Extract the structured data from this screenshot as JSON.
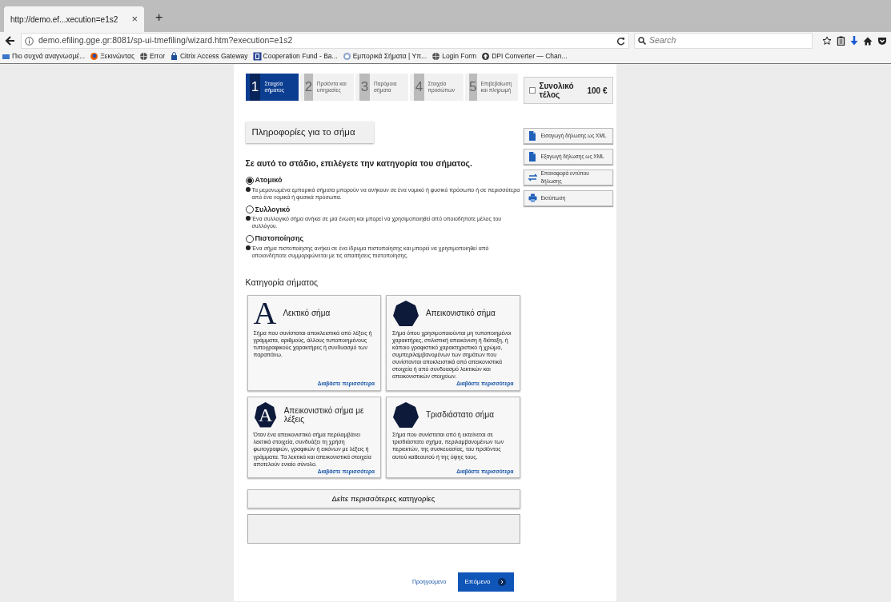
{
  "browser": {
    "tab": {
      "title": "http://demo.ef...xecution=e1s2",
      "close": "×",
      "new_tab": "+"
    },
    "url": "demo.efiling.gge.gr:8081/sp-ui-tmefiling/wizard.htm?execution=e1s2",
    "search": {
      "placeholder": "Search"
    },
    "bookmarks": [
      {
        "label": "Πιο συχνά αναγνωσμέ...",
        "kind": "folder"
      },
      {
        "label": "Ξεκινώντας",
        "kind": "firefox"
      },
      {
        "label": "Error",
        "kind": "globe"
      },
      {
        "label": "Citrix Access Gateway",
        "kind": "lock"
      },
      {
        "label": "Cooperation Fund - Ba...",
        "kind": "b"
      },
      {
        "label": "Εμπορικά Σήματα | Υπ...",
        "kind": "seal"
      },
      {
        "label": "Login Form",
        "kind": "globe"
      },
      {
        "label": "DPI Converter — Chan...",
        "kind": "up"
      }
    ]
  },
  "steps": [
    {
      "number": "1",
      "label": "Στοιχεία σήματος",
      "selected": true
    },
    {
      "number": "2",
      "label": "Προϊόντα και υπηρεσίες",
      "selected": false
    },
    {
      "number": "3",
      "label": "Παρόμοια σήματα",
      "selected": false
    },
    {
      "number": "4",
      "label": "Στοιχεία προσώπων",
      "selected": false
    },
    {
      "number": "5",
      "label": "Επιβεβαίωση και πληρωμή",
      "selected": false
    }
  ],
  "fee": {
    "label": "Συνολικό τέλος",
    "amount": "100 €"
  },
  "side_buttons": [
    {
      "label": "Εισαγωγή δήλωσης ως XML",
      "kind": "file"
    },
    {
      "label": "Εξαγωγή δήλωσης ως XML",
      "kind": "file"
    },
    {
      "label": "Επαναφορά εντύπου δήλωσης",
      "kind": "swap"
    },
    {
      "label": "Εκτύπωση",
      "kind": "print"
    }
  ],
  "section_title": "Πληροφορίες για το σήμα",
  "question": "Σε αυτό το στάδιο, επιλέγετε την κατηγορία του σήματος.",
  "options": [
    {
      "label": "Ατομικό",
      "selected": true,
      "help": "Τα μεμονωμένα εμπορικά σήματα μπορούν να ανήκουν σε ένα νομικό ή φυσικό πρόσωπο ή σε περισσότερα από ένα νομικά ή φυσικά πρόσωπα."
    },
    {
      "label": "Συλλογικό",
      "selected": false,
      "help": "Ένα συλλογικό σήμα ανήκει σε μια ένωση και μπορεί να χρησιμοποιηθεί από οποιοδήποτε μέλος του συλλόγου."
    },
    {
      "label": "Πιστοποίησης",
      "selected": false,
      "help": "Ένα σήμα πιστοποίησης ανήκει σε ένα ίδρυμα πιστοποίησης και μπορεί να χρησιμοποιηθεί από οποιονδήποτε συμμορφώνεται με τις απαιτήσεις πιστοποίησης."
    }
  ],
  "category_title": "Κατηγορία σήματος",
  "categories": [
    {
      "title": "Λεκτικό σήμα",
      "kind": "letter",
      "icon_text": "A",
      "description": "Σήμα που συνίσταται αποκλειστικά από λέξεις ή γράμματα, αριθμούς, άλλους τυποποιημένους τυπογραφικούς χαρακτήρες ή συνδυασμό των παραπάνω.",
      "link": "Διαβάστε περισσότερα"
    },
    {
      "title": "Απεικονιστικό σήμα",
      "kind": "shape",
      "description": "Σήμα όπου χρησιμοποιούνται μη τυποποιημένοι χαρακτήρες, στιλιστική απεικόνιση ή διάταξη, ή κάποιο γραφιστικό χαρακτηριστικό ή χρώμα, συμπεριλαμβανομένων των σημάτων που συνίστανται αποκλειστικά από απεικονιστικά στοιχεία ή από συνδυασμό λεκτικών και απεικονιστικών στοιχείων.",
      "link": "Διαβάστε περισσότερα"
    },
    {
      "title": "Απεικονιστικό σήμα με λέξεις",
      "kind": "shape_letter",
      "icon_text": "A",
      "description": "Όταν ένα απεικονιστικό σήμα περιλαμβάνει λεκτικά στοιχεία, συνδυάζει τη χρήση φωτογραφιών, γραφικών ή εικόνων με λέξεις ή γράμματα. Τα λεκτικά και απεικονιστικά στοιχεία αποτελούν ενιαίο σύνολο.",
      "link": "Διαβάστε περισσότερα"
    },
    {
      "title": "Τρισδιάστατο σήμα",
      "kind": "shape",
      "description": "Σήμα που συνίσταται από ή εκτείνεται σε τρισδιάστατο σχήμα, περιλαμβανομένων των περιεκτών, της συσκευασίας, του προϊόντος αυτού καθεαυτού ή της όψης τους.",
      "link": "Διαβάστε περισσότερα"
    }
  ],
  "more_categories": "Δείτε περισσότερες κατηγορίες",
  "nav": {
    "previous": "Προηγούμενο",
    "next": "Επόμενο"
  }
}
